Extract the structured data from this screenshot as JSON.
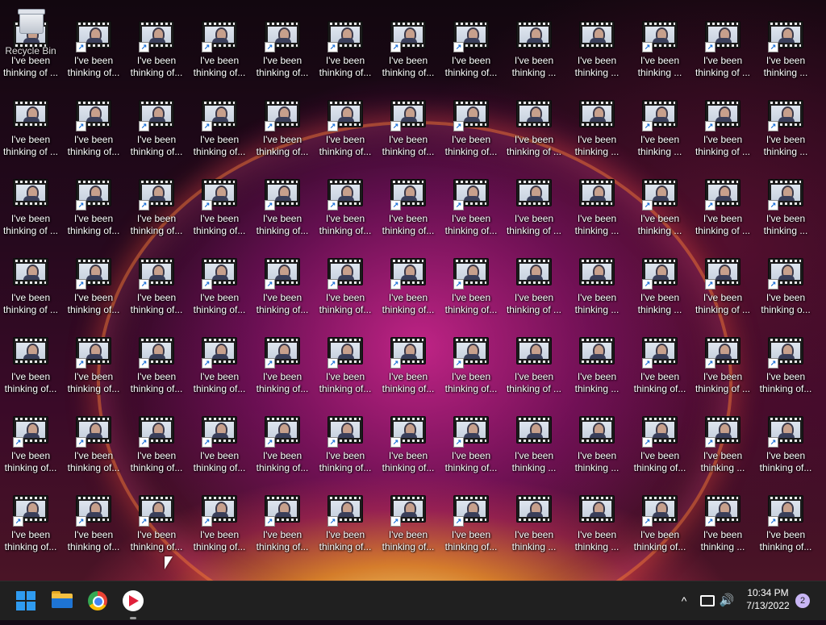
{
  "desktop": {
    "recycle_bin": {
      "label": "Recycle Bin",
      "icon": "recycle-bin-icon"
    },
    "file_icon": "video-file-icon",
    "rows": [
      [
        [
          "thinking of ...",
          false
        ],
        [
          "thinking of...",
          true
        ],
        [
          "thinking of...",
          true
        ],
        [
          "thinking of...",
          true
        ],
        [
          "thinking of...",
          true
        ],
        [
          "thinking of...",
          true
        ],
        [
          "thinking of...",
          true
        ],
        [
          "thinking of...",
          true
        ],
        [
          "thinking ...",
          false
        ],
        [
          "thinking ...",
          false
        ],
        [
          "thinking ...",
          true
        ],
        [
          "thinking of ...",
          true
        ],
        [
          "thinking ...",
          true
        ]
      ],
      [
        [
          "thinking of ...",
          false
        ],
        [
          "thinking of...",
          true
        ],
        [
          "thinking of...",
          true
        ],
        [
          "thinking of...",
          true
        ],
        [
          "thinking of...",
          true
        ],
        [
          "thinking of...",
          true
        ],
        [
          "thinking of...",
          true
        ],
        [
          "thinking of...",
          true
        ],
        [
          "thinking of ...",
          false
        ],
        [
          "thinking ...",
          false
        ],
        [
          "thinking ...",
          true
        ],
        [
          "thinking of ...",
          true
        ],
        [
          "thinking ...",
          true
        ]
      ],
      [
        [
          "thinking of ...",
          false
        ],
        [
          "thinking of...",
          true
        ],
        [
          "thinking of...",
          true
        ],
        [
          "thinking of...",
          true
        ],
        [
          "thinking of...",
          true
        ],
        [
          "thinking of...",
          true
        ],
        [
          "thinking of...",
          true
        ],
        [
          "thinking of...",
          true
        ],
        [
          "thinking of ...",
          false
        ],
        [
          "thinking ...",
          false
        ],
        [
          "thinking ...",
          true
        ],
        [
          "thinking of ...",
          true
        ],
        [
          "thinking ...",
          true
        ]
      ],
      [
        [
          "thinking of ...",
          false
        ],
        [
          "thinking of...",
          true
        ],
        [
          "thinking of...",
          true
        ],
        [
          "thinking of...",
          true
        ],
        [
          "thinking of...",
          true
        ],
        [
          "thinking of...",
          true
        ],
        [
          "thinking of...",
          true
        ],
        [
          "thinking of...",
          true
        ],
        [
          "thinking of ...",
          false
        ],
        [
          "thinking ...",
          false
        ],
        [
          "thinking ...",
          true
        ],
        [
          "thinking of ...",
          true
        ],
        [
          "thinking o...",
          true
        ]
      ],
      [
        [
          "thinking of...",
          false
        ],
        [
          "thinking of...",
          true
        ],
        [
          "thinking of...",
          true
        ],
        [
          "thinking of...",
          true
        ],
        [
          "thinking of...",
          true
        ],
        [
          "thinking of...",
          true
        ],
        [
          "thinking of...",
          true
        ],
        [
          "thinking of...",
          true
        ],
        [
          "thinking of ...",
          false
        ],
        [
          "thinking ...",
          false
        ],
        [
          "thinking of...",
          true
        ],
        [
          "thinking of ...",
          true
        ],
        [
          "thinking of...",
          true
        ]
      ],
      [
        [
          "thinking of...",
          true
        ],
        [
          "thinking of...",
          true
        ],
        [
          "thinking of...",
          true
        ],
        [
          "thinking of...",
          true
        ],
        [
          "thinking of...",
          true
        ],
        [
          "thinking of...",
          true
        ],
        [
          "thinking of...",
          true
        ],
        [
          "thinking of...",
          true
        ],
        [
          "thinking ...",
          false
        ],
        [
          "thinking ...",
          false
        ],
        [
          "thinking of...",
          true
        ],
        [
          "thinking ...",
          true
        ],
        [
          "thinking of...",
          true
        ]
      ],
      [
        [
          "thinking of...",
          true
        ],
        [
          "thinking of...",
          true
        ],
        [
          "thinking of...",
          true
        ],
        [
          "thinking of...",
          true
        ],
        [
          "thinking of...",
          true
        ],
        [
          "thinking of...",
          true
        ],
        [
          "thinking of...",
          true
        ],
        [
          "thinking of...",
          true
        ],
        [
          "thinking ...",
          false
        ],
        [
          "thinking ...",
          false
        ],
        [
          "thinking of...",
          true
        ],
        [
          "thinking ...",
          true
        ],
        [
          "thinking of...",
          true
        ]
      ]
    ],
    "label_line1": "I've been"
  },
  "taskbar": {
    "start_icon": "windows-start-icon",
    "explorer_icon": "file-explorer-icon",
    "chrome_icon": "chrome-icon",
    "app_icon": "media-player-icon",
    "tray_chevron": "^",
    "volume_glyph": "🔊",
    "time": "10:34 PM",
    "date": "7/13/2022",
    "notification_count": "2"
  },
  "colors": {
    "taskbar_bg": "#202020",
    "start_blue": "#2f9bf0",
    "badge": "#c9b6f5"
  }
}
